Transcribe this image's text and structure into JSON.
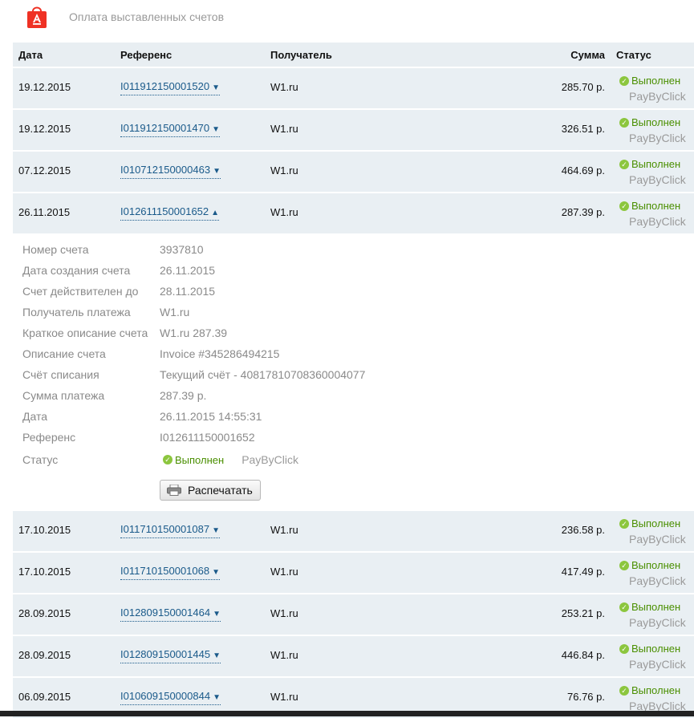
{
  "header": {
    "title": "Оплата выставленных счетов"
  },
  "columns": {
    "date": "Дата",
    "ref": "Референс",
    "recipient": "Получатель",
    "sum": "Сумма",
    "status": "Статус"
  },
  "rows_top": [
    {
      "date": "19.12.2015",
      "ref": "I011912150001520",
      "arrow": "▼",
      "recipient": "W1.ru",
      "sum": "285.70 р.",
      "status": "Выполнен",
      "method": "PayByClick"
    },
    {
      "date": "19.12.2015",
      "ref": "I011912150001470",
      "arrow": "▼",
      "recipient": "W1.ru",
      "sum": "326.51 р.",
      "status": "Выполнен",
      "method": "PayByClick"
    },
    {
      "date": "07.12.2015",
      "ref": "I010712150000463",
      "arrow": "▼",
      "recipient": "W1.ru",
      "sum": "464.69 р.",
      "status": "Выполнен",
      "method": "PayByClick"
    },
    {
      "date": "26.11.2015",
      "ref": "I012611150001652",
      "arrow": "▲",
      "recipient": "W1.ru",
      "sum": "287.39 р.",
      "status": "Выполнен",
      "method": "PayByClick"
    }
  ],
  "details": {
    "items": [
      {
        "key": "Номер счета",
        "value": "3937810"
      },
      {
        "key": "Дата создания счета",
        "value": "26.11.2015"
      },
      {
        "key": "Счет действителен до",
        "value": "28.11.2015"
      },
      {
        "key": "Получатель платежа",
        "value": "W1.ru"
      },
      {
        "key": "Краткое описание счета",
        "value": "W1.ru 287.39"
      },
      {
        "key": "Описание счета",
        "value": "Invoice #345286494215"
      },
      {
        "key": "Счёт списания",
        "value": "Текущий счёт - 40817810708360004077"
      },
      {
        "key": "Сумма платежа",
        "value": "287.39 р."
      },
      {
        "key": "Дата",
        "value": "26.11.2015 14:55:31"
      },
      {
        "key": "Референс",
        "value": "I012611150001652"
      }
    ],
    "status_key": "Статус",
    "status_value": "Выполнен",
    "status_method": "PayByClick",
    "print_label": "Распечатать"
  },
  "rows_bottom": [
    {
      "date": "17.10.2015",
      "ref": "I011710150001087",
      "arrow": "▼",
      "recipient": "W1.ru",
      "sum": "236.58 р.",
      "status": "Выполнен",
      "method": "PayByClick"
    },
    {
      "date": "17.10.2015",
      "ref": "I011710150001068",
      "arrow": "▼",
      "recipient": "W1.ru",
      "sum": "417.49 р.",
      "status": "Выполнен",
      "method": "PayByClick"
    },
    {
      "date": "28.09.2015",
      "ref": "I012809150001464",
      "arrow": "▼",
      "recipient": "W1.ru",
      "sum": "253.21 р.",
      "status": "Выполнен",
      "method": "PayByClick"
    },
    {
      "date": "28.09.2015",
      "ref": "I012809150001445",
      "arrow": "▼",
      "recipient": "W1.ru",
      "sum": "446.84 р.",
      "status": "Выполнен",
      "method": "PayByClick"
    },
    {
      "date": "06.09.2015",
      "ref": "I010609150000844",
      "arrow": "▼",
      "recipient": "W1.ru",
      "sum": "76.76 р.",
      "status": "Выполнен",
      "method": "PayByClick"
    }
  ],
  "icons": {
    "logo": "alfa-bank-bag-icon",
    "check": "check-circle-icon",
    "printer": "printer-icon"
  },
  "colors": {
    "row_bg": "#e9eff3",
    "accent": "#ef3124",
    "link": "#1a5a8a",
    "ok": "#4a8f00"
  }
}
